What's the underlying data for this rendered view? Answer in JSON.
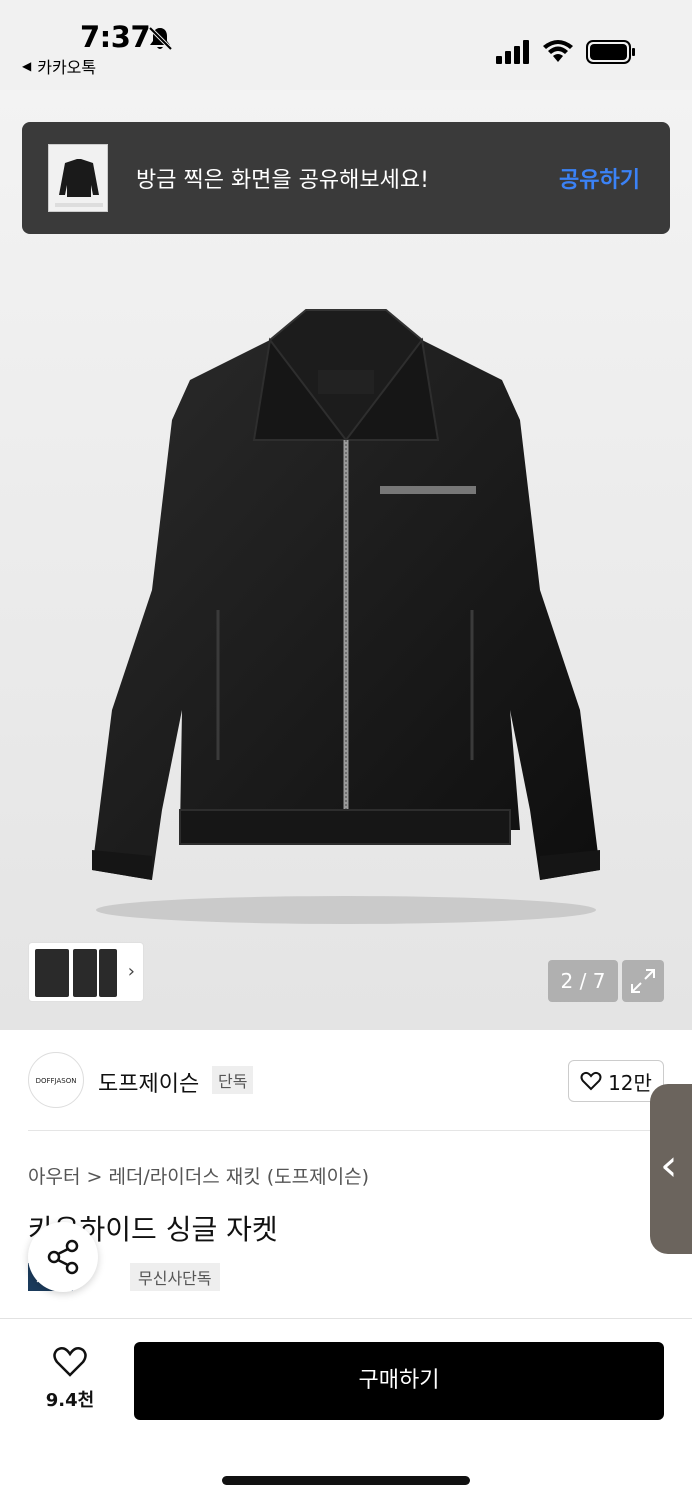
{
  "status_bar": {
    "time": "7:37",
    "back_app": "카카오톡",
    "back_glyph": "◀"
  },
  "toast": {
    "message": "방금 찍은 화면을 공유해보세요!",
    "action": "공유하기",
    "action_color": "#3b82f6"
  },
  "gallery": {
    "counter": "2 / 7",
    "thumbs_arrow": "›"
  },
  "brand": {
    "logo_text": "DOFFJASON",
    "name": "도프제이슨",
    "badge": "단독",
    "like_count": "12만"
  },
  "product": {
    "breadcrumb": "아우터 > 레더/라이더스 재킷 (도프제이슨)",
    "title": "카우하이드 싱글 자켓",
    "tag_primary": "세이",
    "tag_secondary": "무신사단독"
  },
  "side_handle": {
    "glyph": "‹"
  },
  "bottom_bar": {
    "wish_count": "9.4천",
    "buy_label": "구매하기"
  },
  "colors": {
    "buy_button": "#000000",
    "tag_primary_bg": "#1b3b5c",
    "toast_bg": "#3a3a3a"
  }
}
